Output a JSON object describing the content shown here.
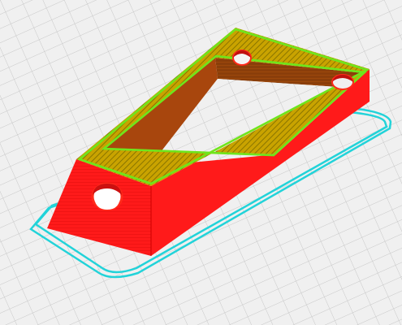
{
  "viewport": {
    "view": "layer-view",
    "colors": {
      "background": "#f0f0f0",
      "grid": "#c8c8c8",
      "outer_wall": "#ff1a1a",
      "inner_wall": "#6fe51c",
      "top_infill": "#c9a900",
      "skirt": "#22d3d9"
    }
  }
}
